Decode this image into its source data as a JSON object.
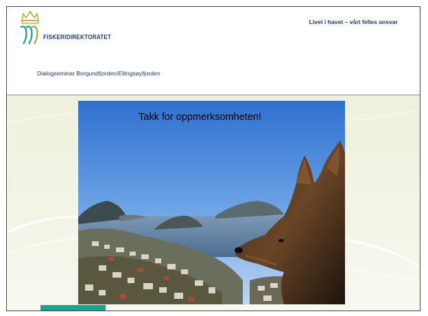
{
  "header": {
    "logo_text": "FISKERIDIREKTORATET",
    "tagline": "Livet i havet – vårt felles ansvar",
    "seminar_title": "Dialogseminar Borgundfjorden/Ellingsøyfjorden"
  },
  "content": {
    "photo_caption": "Takk for oppmerksomheten!"
  },
  "colors": {
    "brand_navy": "#1f3a6b",
    "accent_teal": "#1aa28f",
    "background_cream": "#eef1dd"
  }
}
